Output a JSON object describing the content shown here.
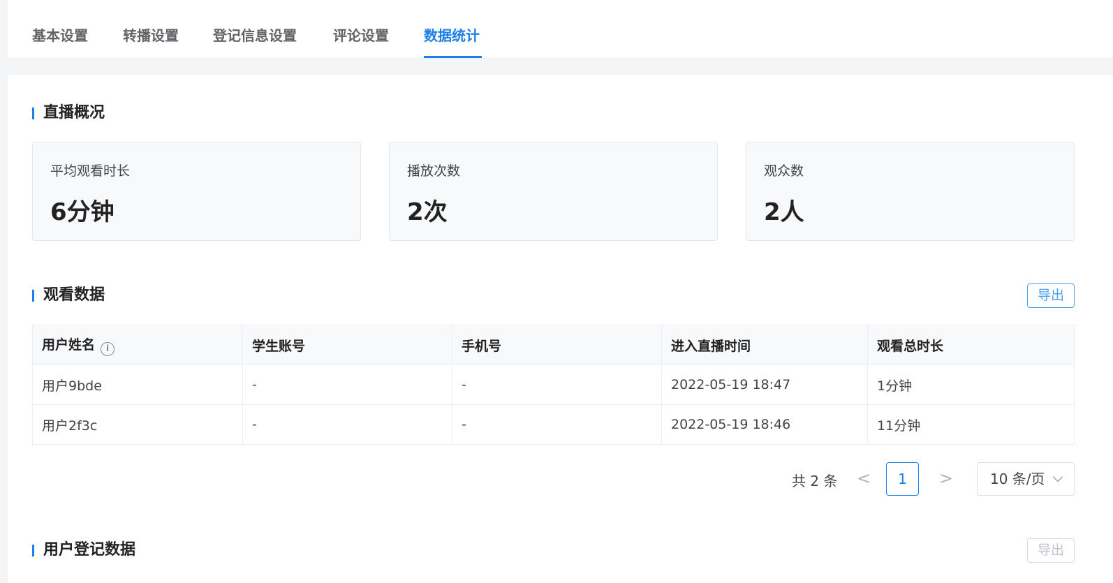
{
  "tabs": [
    {
      "label": "基本设置"
    },
    {
      "label": "转播设置"
    },
    {
      "label": "登记信息设置"
    },
    {
      "label": "评论设置"
    },
    {
      "label": "数据统计"
    }
  ],
  "active_tab": "数据统计",
  "overview": {
    "title": "直播概况",
    "cards": [
      {
        "label": "平均观看时长",
        "value": "6分钟"
      },
      {
        "label": "播放次数",
        "value": "2次"
      },
      {
        "label": "观众数",
        "value": "2人"
      }
    ]
  },
  "watch": {
    "title": "观看数据",
    "export_label": "导出",
    "columns": [
      "用户姓名",
      "学生账号",
      "手机号",
      "进入直播时间",
      "观看总时长"
    ],
    "rows": [
      [
        "用户9bde",
        "-",
        "-",
        "2022-05-19 18:47",
        "1分钟"
      ],
      [
        "用户2f3c",
        "-",
        "-",
        "2022-05-19 18:46",
        "11分钟"
      ]
    ],
    "pagination": {
      "total_label": "共 2 条",
      "current_page": "1",
      "page_size_label": "10 条/页",
      "prev_icon": "<",
      "next_icon": ">"
    }
  },
  "register": {
    "title": "用户登记数据",
    "export_label": "导出"
  },
  "colors": {
    "accent": "#1d7fe8",
    "export_border": "#4aa0ee"
  }
}
